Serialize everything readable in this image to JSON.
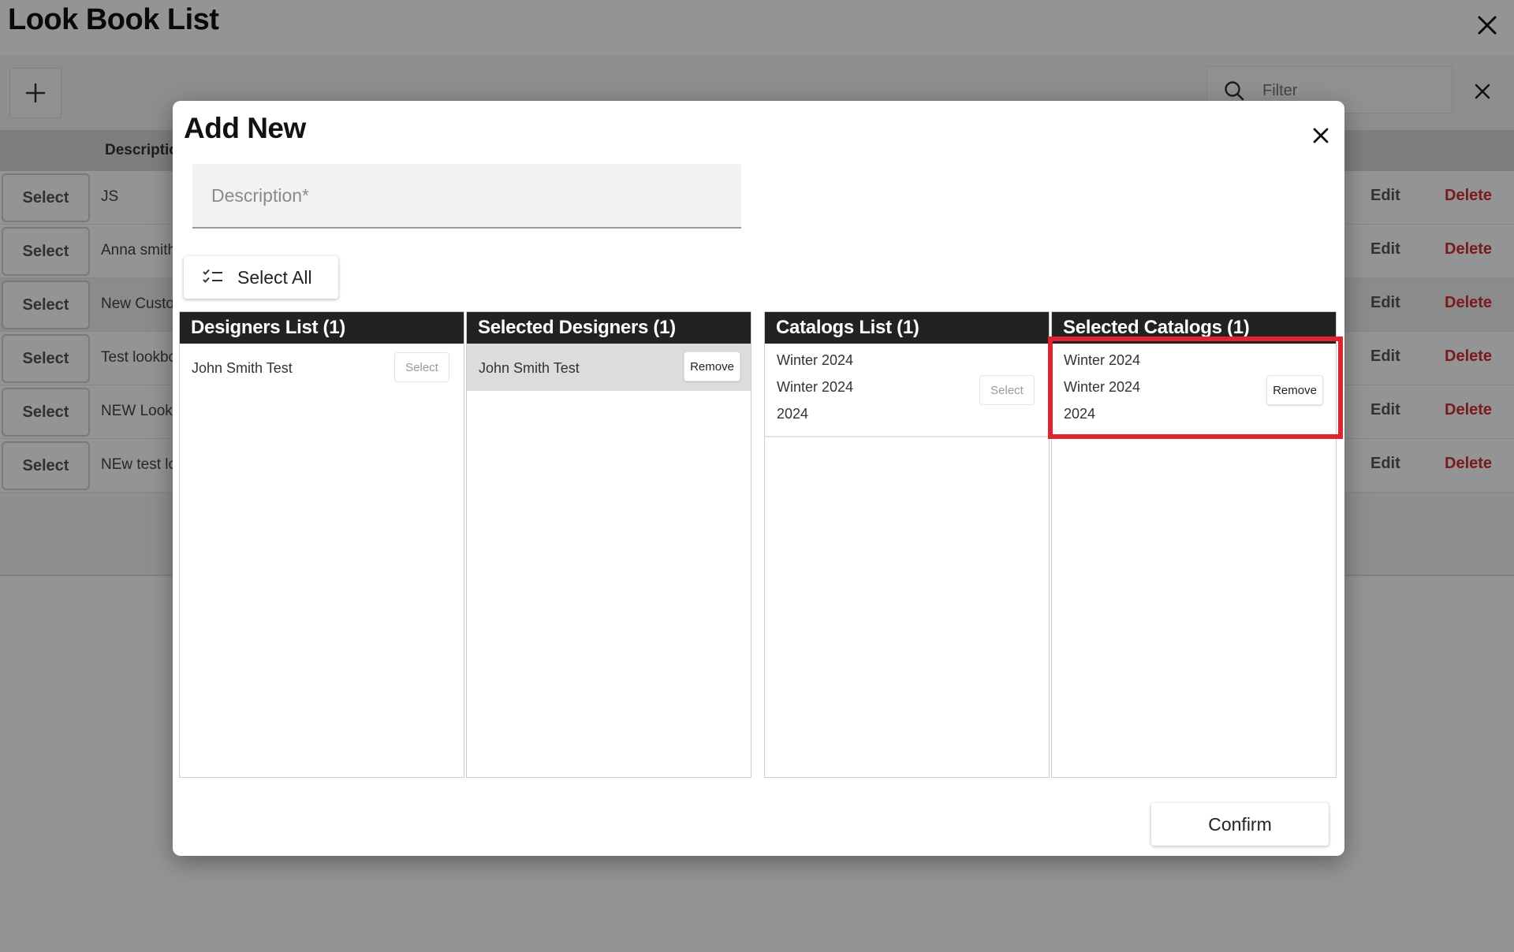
{
  "page": {
    "title": "Look Book List",
    "filter_placeholder": "Filter",
    "table_header": {
      "description": "Descriptio"
    },
    "rows": [
      {
        "select_label": "Select",
        "description": "JS",
        "edit_label": "Edit",
        "delete_label": "Delete"
      },
      {
        "select_label": "Select",
        "description": "Anna smith",
        "edit_label": "Edit",
        "delete_label": "Delete"
      },
      {
        "select_label": "Select",
        "description": "New Custo",
        "edit_label": "Edit",
        "delete_label": "Delete"
      },
      {
        "select_label": "Select",
        "description": "Test lookbo",
        "edit_label": "Edit",
        "delete_label": "Delete"
      },
      {
        "select_label": "Select",
        "description": "NEW Look",
        "edit_label": "Edit",
        "delete_label": "Delete"
      },
      {
        "select_label": "Select",
        "description": "NEw test lo",
        "edit_label": "Edit",
        "delete_label": "Delete"
      }
    ]
  },
  "modal": {
    "title": "Add New",
    "description_placeholder": "Description*",
    "select_all_label": "Select All",
    "confirm_label": "Confirm",
    "panels": {
      "designers_list": {
        "title": "Designers List (1)",
        "items": [
          {
            "name": "John Smith Test",
            "button": "Select"
          }
        ]
      },
      "selected_designers": {
        "title": "Selected Designers (1)",
        "items": [
          {
            "name": "John Smith Test",
            "button": "Remove"
          }
        ]
      },
      "catalogs_list": {
        "title": "Catalogs List (1)",
        "items": [
          {
            "lines": [
              "Winter 2024",
              "Winter 2024",
              "2024"
            ],
            "button": "Select"
          }
        ]
      },
      "selected_catalogs": {
        "title": "Selected Catalogs (1)",
        "items": [
          {
            "lines": [
              "Winter 2024",
              "Winter 2024",
              "2024"
            ],
            "button": "Remove"
          }
        ]
      }
    }
  },
  "colors": {
    "delete_red": "#d32f2f",
    "panel_header": "#222222",
    "highlight_red": "#e0232e"
  }
}
